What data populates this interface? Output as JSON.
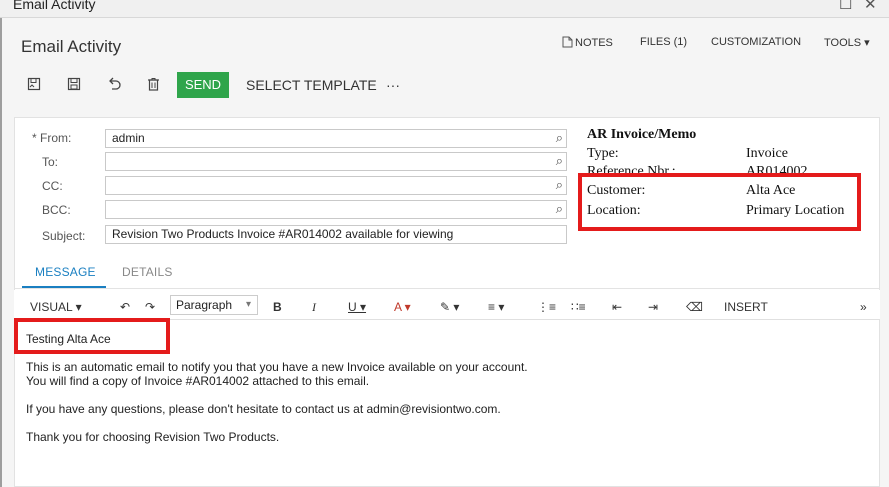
{
  "window": {
    "title": "Email Activity",
    "maximize_glyph": "☐",
    "close_glyph": "✕"
  },
  "page": {
    "title": "Email Activity"
  },
  "top_menu": {
    "notes": "NOTES",
    "files": "FILES (1)",
    "customization": "CUSTOMIZATION",
    "tools": "TOOLS ▾"
  },
  "toolbar": {
    "save_close_icon": "save-close-icon",
    "save_icon": "save-icon",
    "undo_icon": "undo-icon",
    "delete_icon": "delete-icon",
    "send_label": "SEND",
    "select_template_label": "SELECT TEMPLATE",
    "more_label": "···"
  },
  "form": {
    "from_label": "* From:",
    "from_value": "admin",
    "to_label": "To:",
    "to_value": "",
    "cc_label": "CC:",
    "cc_value": "",
    "bcc_label": "BCC:",
    "bcc_value": "",
    "subject_label": "Subject:",
    "subject_value": "Revision Two Products Invoice #AR014002 available for viewing"
  },
  "info_panel": {
    "heading": "AR Invoice/Memo",
    "type_label": "Type:",
    "type_value": "Invoice",
    "refnbr_label": "Reference Nbr.:",
    "refnbr_value": "AR014002",
    "customer_label": "Customer:",
    "customer_value": "Alta Ace",
    "location_label": "Location:",
    "location_value": "Primary Location"
  },
  "tabs": {
    "message": "MESSAGE",
    "details": "DETAILS"
  },
  "editor_toolbar": {
    "visual": "VISUAL ▾",
    "undo": "↶",
    "redo": "↷",
    "paragraph": "Paragraph",
    "para_caret": "▾",
    "bold": "B",
    "italic": "I",
    "underline": "U ▾",
    "font_color": "A ▾",
    "highlight": "✎ ▾",
    "align": "≡ ▾",
    "ol": "⋮≡",
    "ul": "∷≡",
    "outdent": "⇤",
    "indent": "⇥",
    "justify": "≣",
    "clear": "⌫",
    "insert": "INSERT",
    "expand": "»"
  },
  "body": {
    "line1": "Testing  Alta Ace",
    "line2": "This is an automatic email to notify you that you have a new Invoice available on your account.",
    "line3": "You will find a copy of Invoice #AR014002 attached to this email.",
    "line4": "If you have any questions, please don't hesitate to contact us at admin@revisiontwo.com.",
    "line5": "Thank you for choosing Revision Two Products."
  },
  "colors": {
    "accent": "#1a7fc1",
    "send": "#2fa54b",
    "highlight_box": "#e41b1b"
  }
}
